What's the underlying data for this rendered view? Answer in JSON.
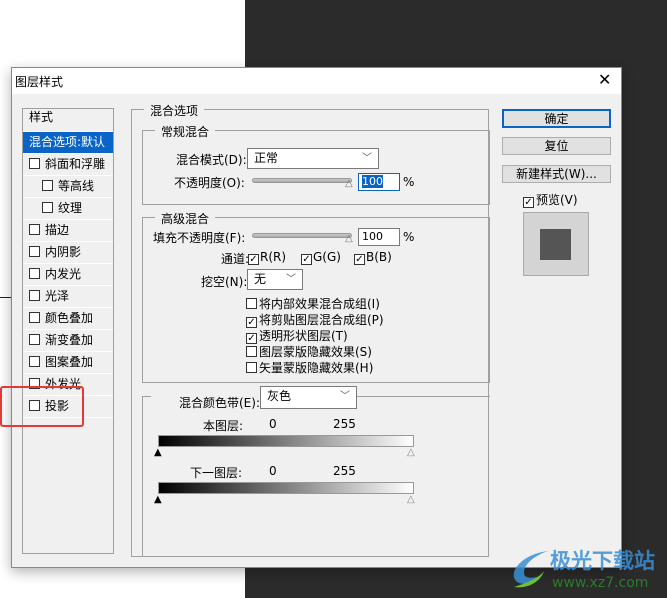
{
  "dialog": {
    "title": "图层样式",
    "close_icon": "close-icon"
  },
  "style_list": {
    "header": "样式",
    "items": [
      {
        "label": "混合选项:默认",
        "selected": true,
        "checkbox": false
      },
      {
        "label": "斜面和浮雕",
        "checked": false
      },
      {
        "label": "等高线",
        "checked": false,
        "indent": true
      },
      {
        "label": "纹理",
        "checked": false,
        "indent": true
      },
      {
        "label": "描边",
        "checked": false
      },
      {
        "label": "内阴影",
        "checked": false
      },
      {
        "label": "内发光",
        "checked": false
      },
      {
        "label": "光泽",
        "checked": false
      },
      {
        "label": "颜色叠加",
        "checked": false
      },
      {
        "label": "渐变叠加",
        "checked": false
      },
      {
        "label": "图案叠加",
        "checked": false
      },
      {
        "label": "外发光",
        "checked": false
      },
      {
        "label": "投影",
        "checked": false
      }
    ]
  },
  "blend": {
    "title": "混合选项",
    "general": {
      "title": "常规混合",
      "mode_label": "混合模式(D):",
      "mode_value": "正常",
      "opacity_label": "不透明度(O):",
      "opacity_value": "100",
      "unit": "%"
    },
    "advanced": {
      "title": "高级混合",
      "fill_label": "填充不透明度(F):",
      "fill_value": "100",
      "unit": "%",
      "channels_label": "通道:",
      "r": "R(R)",
      "g": "G(G)",
      "b": "B(B)",
      "knockout_label": "挖空(N):",
      "knockout_value": "无",
      "options": [
        {
          "label": "将内部效果混合成组(I)",
          "checked": false
        },
        {
          "label": "将剪贴图层混合成组(P)",
          "checked": true
        },
        {
          "label": "透明形状图层(T)",
          "checked": true
        },
        {
          "label": "图层蒙版隐藏效果(S)",
          "checked": false
        },
        {
          "label": "矢量蒙版隐藏效果(H)",
          "checked": false
        }
      ]
    },
    "blend_if": {
      "label": "混合颜色带(E):",
      "value": "灰色",
      "this_layer": "本图层:",
      "underlying": "下一图层:",
      "min": "0",
      "max": "255"
    }
  },
  "buttons": {
    "ok": "确定",
    "reset": "复位",
    "new_style": "新建样式(W)...",
    "preview": "预览(V)",
    "preview_checked": true
  },
  "watermark": {
    "name": "极光下载站",
    "url": "www.xz7.com"
  }
}
